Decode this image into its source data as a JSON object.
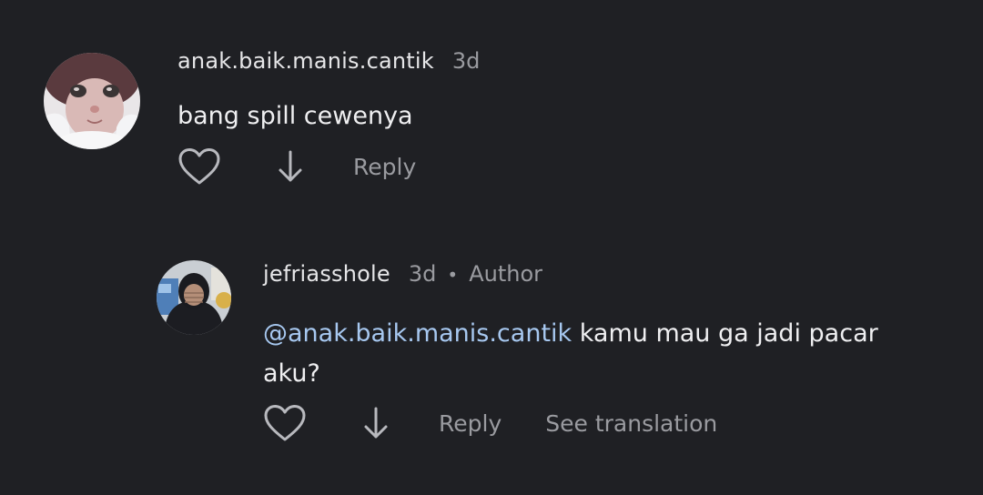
{
  "comments": [
    {
      "username": "anak.baik.manis.cantik",
      "time": "3d",
      "text": "bang spill cewenya",
      "reply_label": "Reply"
    },
    {
      "username": "jefriasshole",
      "time": "3d",
      "separator": "•",
      "author_badge": "Author",
      "mention": "@anak.baik.manis.cantik",
      "text_line1": " kamu mau ga jadi pacar",
      "text_line2": "aku?",
      "reply_label": "Reply",
      "translate_label": "See translation"
    }
  ],
  "icons": {
    "like": "heart-icon",
    "dislike": "arrow-down-icon"
  },
  "colors": {
    "background": "#1f2024",
    "mention": "#a7c8f0",
    "muted": "#9a9ba0"
  }
}
